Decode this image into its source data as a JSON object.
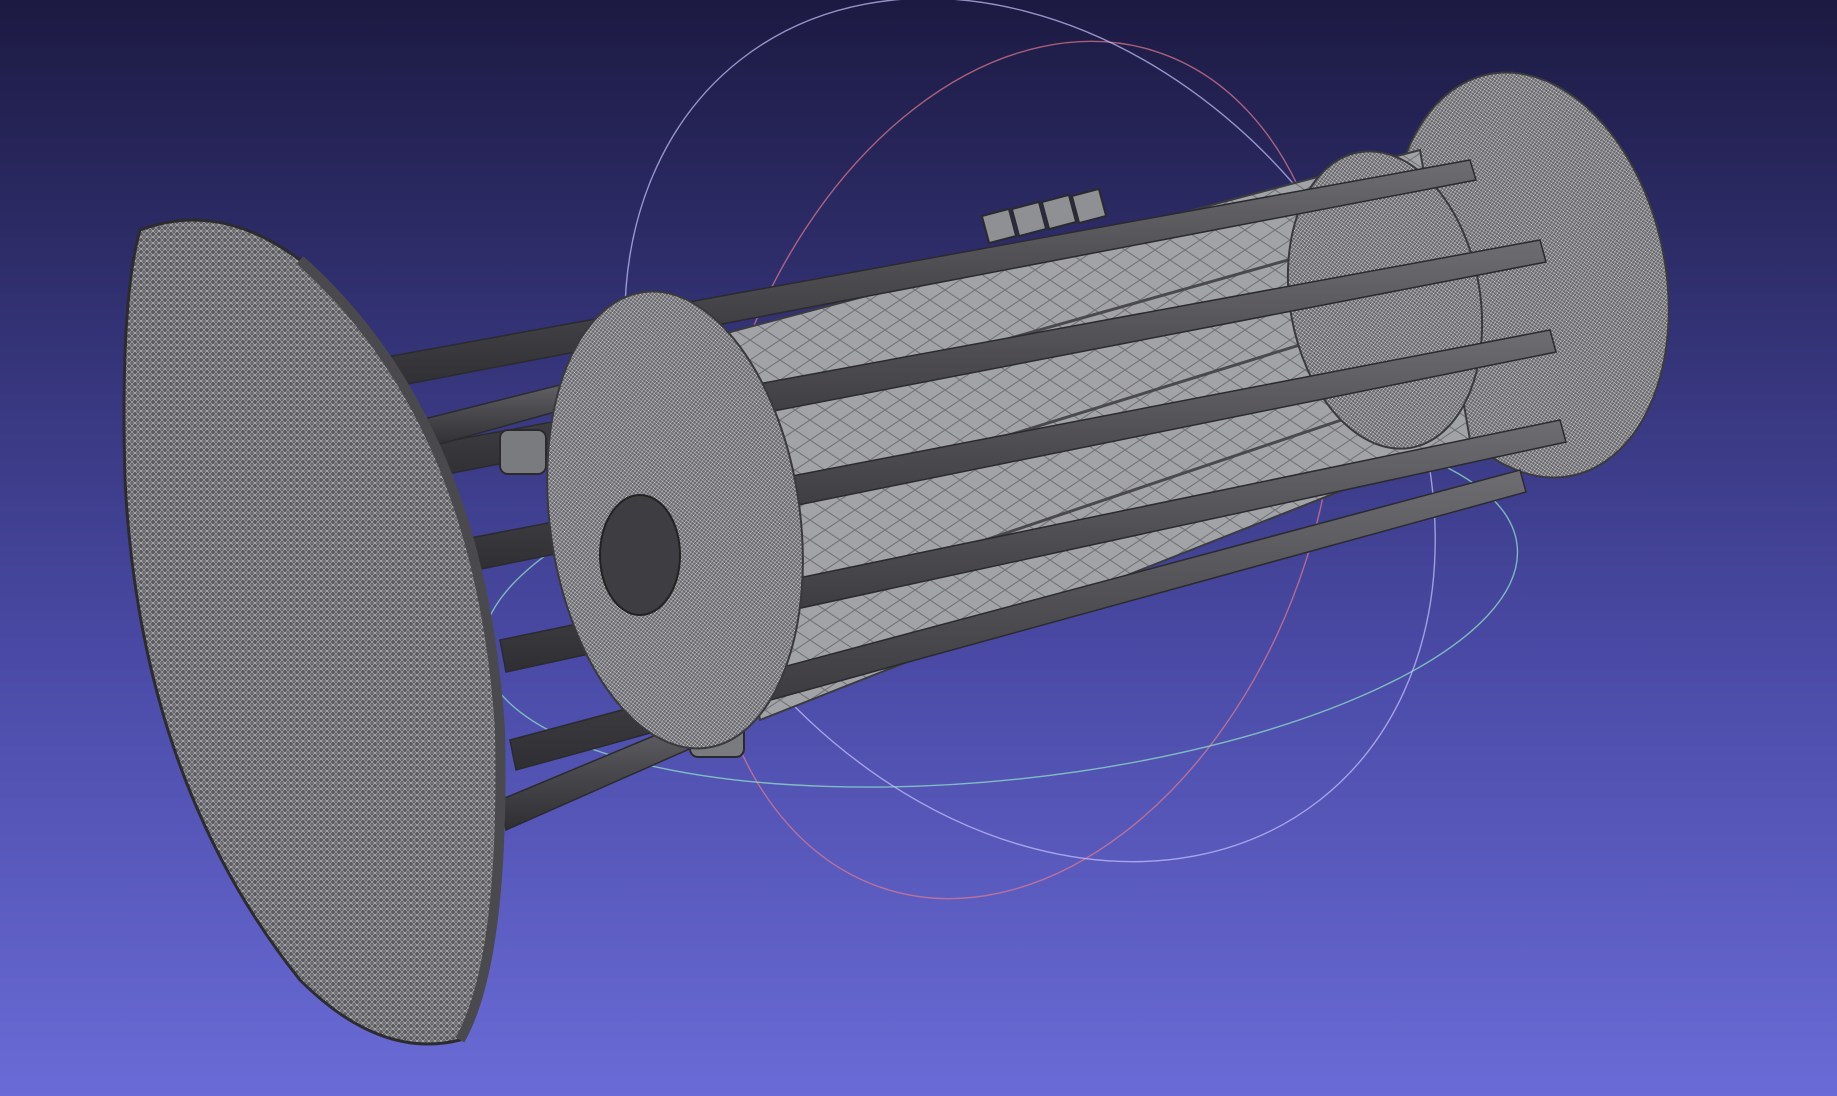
{
  "app": {
    "window_title": ""
  },
  "viewport": {
    "view_mode": "wireframe",
    "model": "space-station-mesh",
    "trackball": "visible",
    "colors": {
      "background_top": "#1c1a42",
      "background_bottom": "#6a6bd6",
      "mesh_fill": "#5b5b5f",
      "mesh_edge": "#cfd0d4",
      "trackball_x": "#e27a8e",
      "trackball_y": "#8fe0c8",
      "trackball_z": "#c9c4ff"
    }
  }
}
